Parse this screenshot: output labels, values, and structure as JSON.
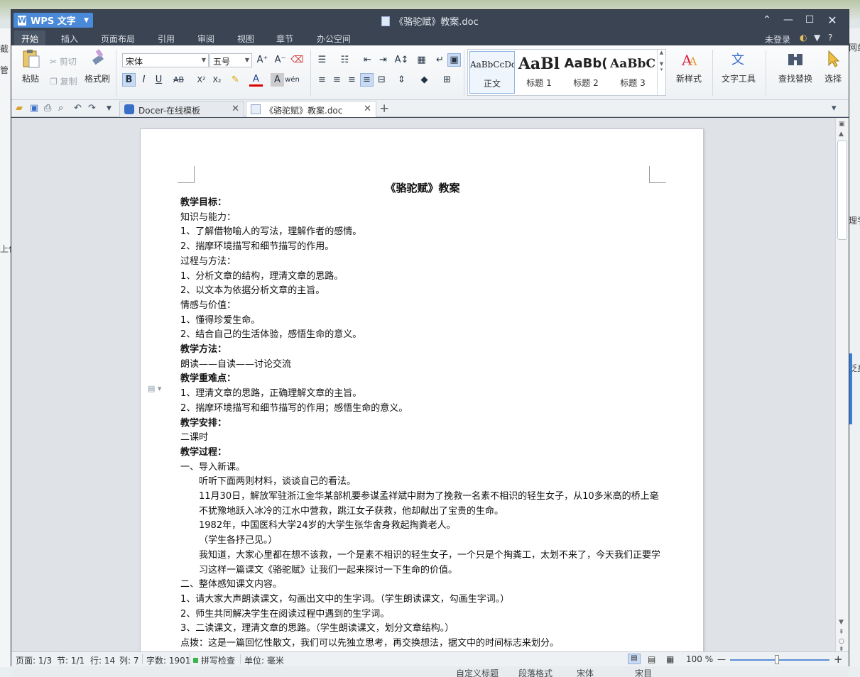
{
  "background": {
    "left_fragments": [
      "截",
      "管",
      "上代"
    ],
    "right_fragments": [
      "网盘",
      "理学",
      "貶身"
    ],
    "bottom_fragments": [
      "自定义标题",
      "段落格式",
      "宋体",
      "宋目"
    ]
  },
  "window": {
    "app_name": "WPS 文字",
    "title": "《骆驼赋》教案.doc",
    "login": "未登录"
  },
  "menu_tabs": [
    "开始",
    "插入",
    "页面布局",
    "引用",
    "审阅",
    "视图",
    "章节",
    "办公空间"
  ],
  "ribbon": {
    "paste": "粘贴",
    "cut": "剪切",
    "copy": "复制",
    "format_painter": "格式刷",
    "font_name": "宋体",
    "font_size": "五号",
    "styles": [
      {
        "preview": "AaBbCcDd",
        "label": "正文"
      },
      {
        "preview": "AaBl",
        "label": "标题 1"
      },
      {
        "preview": "AaBb(",
        "label": "标题 2"
      },
      {
        "preview": "AaBbC",
        "label": "标题 3"
      }
    ],
    "new_style": "新样式",
    "text_tools": "文字工具",
    "find_replace": "查找替换",
    "select": "选择"
  },
  "doc_tabs": [
    {
      "label": "Docer-在线模板"
    },
    {
      "label": "《骆驼赋》教案.doc"
    }
  ],
  "document": {
    "heading": "《骆驼赋》教案",
    "paragraphs": [
      {
        "text": "教学目标：",
        "style": "b"
      },
      {
        "text": "知识与能力：",
        "style": ""
      },
      {
        "text": "1、了解借物喻人的写法，理解作者的感情。",
        "style": ""
      },
      {
        "text": "2、揣摩环境描写和细节描写的作用。",
        "style": ""
      },
      {
        "text": "过程与方法：",
        "style": ""
      },
      {
        "text": "1、分析文章的结构，理清文章的思路。",
        "style": ""
      },
      {
        "text": "2、以文本为依据分析文章的主旨。",
        "style": ""
      },
      {
        "text": "情感与价值：",
        "style": ""
      },
      {
        "text": "1、懂得珍爱生命。",
        "style": ""
      },
      {
        "text": "2、结合自己的生活体验，感悟生命的意义。",
        "style": ""
      },
      {
        "text": "教学方法：",
        "style": "b"
      },
      {
        "text": "朗读——自读——讨论交流",
        "style": ""
      },
      {
        "text": "教学重难点：",
        "style": "b"
      },
      {
        "text": "1、理清文章的思路，正确理解文章的主旨。",
        "style": ""
      },
      {
        "text": "2、揣摩环境描写和细节描写的作用；感悟生命的意义。",
        "style": ""
      },
      {
        "text": "教学安排：",
        "style": "b"
      },
      {
        "text": "二课时",
        "style": ""
      },
      {
        "text": "教学过程：",
        "style": "b"
      },
      {
        "text": "一、导入新课。",
        "style": ""
      },
      {
        "text": "听听下面两则材料，谈谈自己的看法。",
        "style": "ind"
      },
      {
        "text": "11月30日，解放军驻浙江金华某部机要参谋孟祥斌中尉为了挽救一名素不相识的轻生女子，从10多米高的桥上毫不犹豫地跃入冰冷的江水中营救，跳江女子获救，他却献出了宝贵的生命。",
        "style": "ind wrap"
      },
      {
        "text": "1982年，中国医科大学24岁的大学生张华舍身救起掏粪老人。",
        "style": "ind"
      },
      {
        "text": "（学生各抒己见。）",
        "style": "ind"
      },
      {
        "text": "我知道，大家心里都在想不该救，一个是素不相识的轻生女子，一个只是个掏粪工，太划不来了，今天我们正要学习这样一篇课文《骆驼赋》让我们一起来探讨一下生命的价值。",
        "style": "ind wrap"
      },
      {
        "text": "二、整体感知课文内容。",
        "style": ""
      },
      {
        "text": "1、请大家大声朗读课文，勾画出文中的生字词。（学生朗读课文，勾画生字词。）",
        "style": ""
      },
      {
        "text": "2、师生共同解决学生在阅读过程中遇到的生字词。",
        "style": ""
      },
      {
        "text": "3、二读课文，理清文章的思路。（学生朗读课文，划分文章结构。）",
        "style": ""
      },
      {
        "text": "点拨：这是一篇回忆性散文，我们可以先独立思考，再交换想法，据文中的时间标志来划分。",
        "style": ""
      }
    ]
  },
  "status": {
    "page": "页面: 1/3",
    "section": "节: 1/1",
    "row": "行: 14",
    "col": "列: 7",
    "words": "字数: 1901",
    "spell": "拼写检查",
    "unit": "单位: 毫米",
    "zoom": "100 %",
    "zoom_value": 100
  },
  "colors": {
    "titlebar": "#3a4452",
    "accent": "#4a8ad8"
  }
}
